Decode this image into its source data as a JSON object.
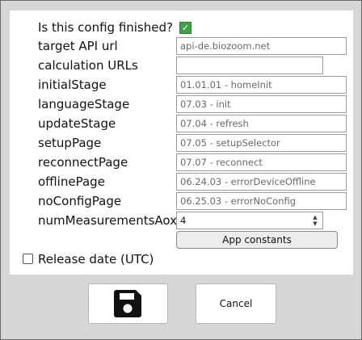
{
  "form": {
    "finished_label": "Is this config finished?",
    "finished_checked": true,
    "fields": [
      {
        "label": "target API url",
        "value": "api-de.biozoom.net"
      },
      {
        "label": "calculation URLs",
        "value": ""
      },
      {
        "label": "initialStage",
        "value": "01.01.01 - homeInit"
      },
      {
        "label": "languageStage",
        "value": "07.03 - init"
      },
      {
        "label": "updateStage",
        "value": "07.04 - refresh"
      },
      {
        "label": "setupPage",
        "value": "07.05 - setupSelector"
      },
      {
        "label": "reconnectPage",
        "value": "07.07 - reconnect"
      },
      {
        "label": "offlinePage",
        "value": "06.24.03 - errorDeviceOffline"
      },
      {
        "label": "noConfigPage",
        "value": "06.25.03 - errorNoConfig"
      },
      {
        "label": "numMeasurementsAox",
        "value": "4"
      }
    ],
    "app_constants_label": "App constants",
    "release_date_label": "Release date (UTC)",
    "release_date_checked": false
  },
  "footer": {
    "save_icon": "floppy-disk-icon",
    "cancel_label": "Cancel"
  }
}
